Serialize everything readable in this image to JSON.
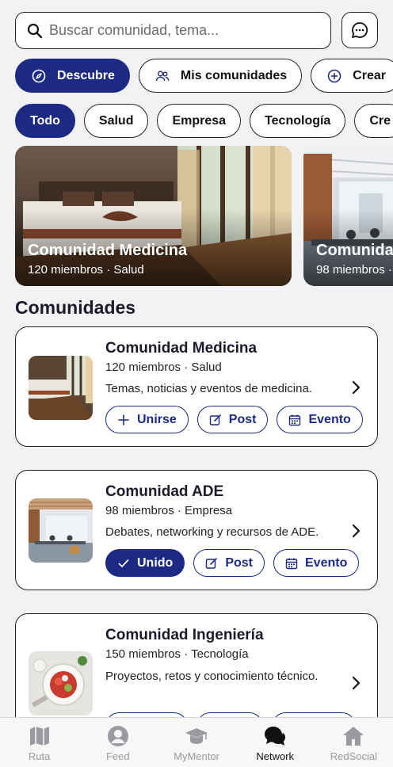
{
  "search": {
    "placeholder": "Buscar comunidad, tema..."
  },
  "nav_pills": [
    {
      "label": "Descubre",
      "icon": "compass-icon",
      "active": true
    },
    {
      "label": "Mis comunidades",
      "icon": "people-icon",
      "active": false
    },
    {
      "label": "Crear",
      "icon": "plus-circle-icon",
      "active": false
    }
  ],
  "categories": [
    {
      "label": "Todo",
      "active": true
    },
    {
      "label": "Salud",
      "active": false
    },
    {
      "label": "Empresa",
      "active": false
    },
    {
      "label": "Tecnología",
      "active": false
    },
    {
      "label": "Cre",
      "active": false
    }
  ],
  "featured": [
    {
      "title": "Comunidad Medicina",
      "subtitle": "120 miembros · Salud"
    },
    {
      "title": "Comunida",
      "subtitle": "98 miembros ·"
    }
  ],
  "section_title": "Comunidades",
  "communities": [
    {
      "name": "Comunidad Medicina",
      "meta": "120 miembros · Salud",
      "desc": "Temas, noticias y eventos de medicina.",
      "join": "Unirse",
      "post": "Post",
      "event": "Evento"
    },
    {
      "name": "Comunidad ADE",
      "meta": "98 miembros · Empresa",
      "desc": "Debates, networking y recursos de ADE.",
      "join": "Unido",
      "post": "Post",
      "event": "Evento"
    },
    {
      "name": "Comunidad Ingeniería",
      "meta": "150 miembros · Tecnología",
      "desc": "Proyectos, retos y conocimiento técnico."
    }
  ],
  "tabs": [
    {
      "label": "Ruta",
      "icon": "map-icon",
      "active": false
    },
    {
      "label": "Feed",
      "icon": "user-circle-icon",
      "active": false
    },
    {
      "label": "MyMentor",
      "icon": "graduation-cap-icon",
      "active": false
    },
    {
      "label": "Network",
      "icon": "chat-bubbles-icon",
      "active": true
    },
    {
      "label": "RedSocial",
      "icon": "home-icon",
      "active": false
    }
  ],
  "colors": {
    "accent": "#1c2a84",
    "background": "#f2f2f4"
  }
}
